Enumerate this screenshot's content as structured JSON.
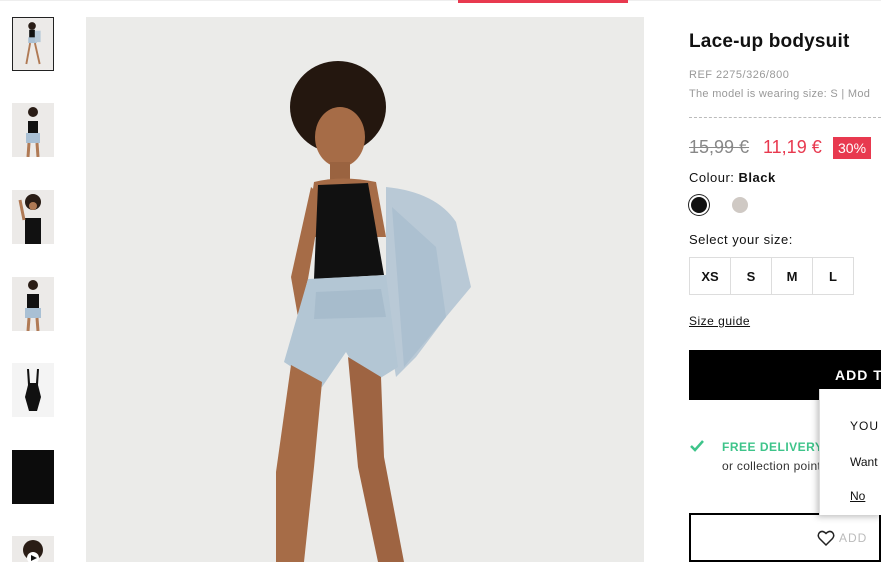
{
  "product": {
    "title": "Lace-up bodysuit",
    "ref": "REF 2275/326/800",
    "model_info": "The model is wearing size: S | Mod",
    "old_price": "15,99 €",
    "new_price": "11,19 €",
    "discount": "30%",
    "colour_label": "Colour:",
    "colour_value": "Black",
    "colours": [
      {
        "name": "black",
        "color": "#111111"
      },
      {
        "name": "grey",
        "color": "#cfc9c4"
      }
    ],
    "select_size_label": "Select your size:",
    "sizes": [
      "XS",
      "S",
      "M",
      "L"
    ],
    "size_guide": "Size guide",
    "add_button": "ADD TO",
    "delivery_title": "FREE DELIVERY TO HOME",
    "delivery_sub": "or collection point for",
    "wishlist_label": "ADD"
  },
  "popup": {
    "title": "YOU A",
    "text": "Want",
    "no": "No"
  },
  "colors": {
    "accent": "#e8394f",
    "delivery": "#3ec48a"
  },
  "thumbnails": [
    {
      "name": "thumb-full-body"
    },
    {
      "name": "thumb-front-crop"
    },
    {
      "name": "thumb-detail"
    },
    {
      "name": "thumb-front"
    },
    {
      "name": "thumb-garment"
    },
    {
      "name": "thumb-fabric"
    },
    {
      "name": "thumb-video"
    }
  ]
}
